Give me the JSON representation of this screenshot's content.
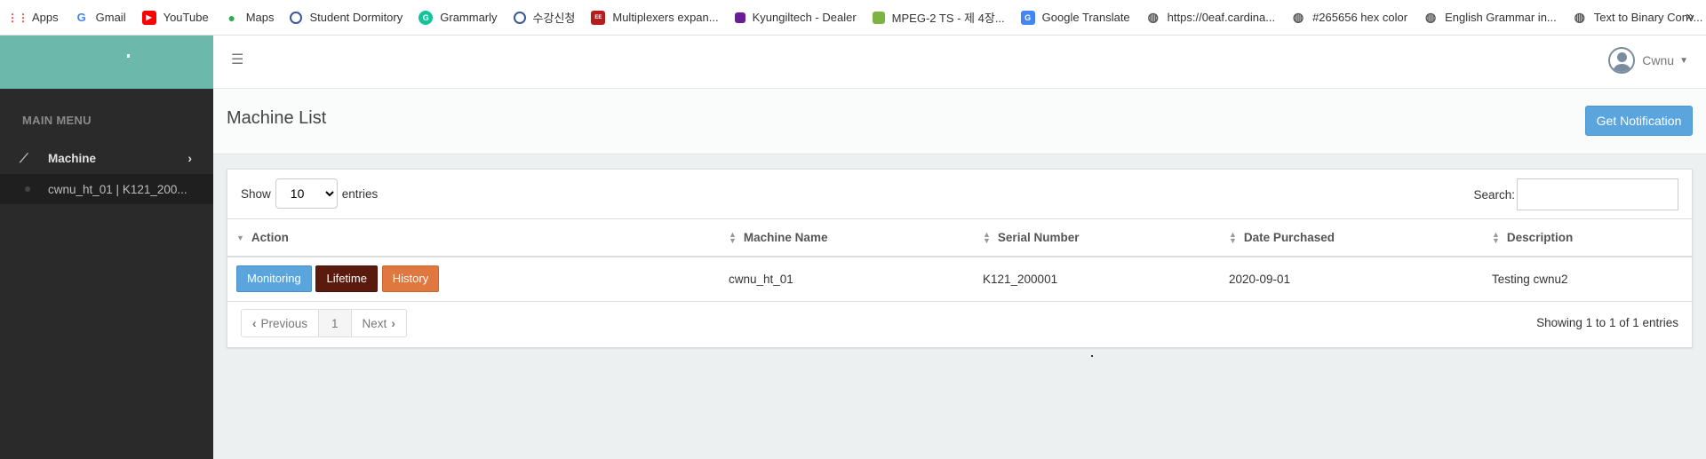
{
  "bookmarks": [
    {
      "label": "Apps",
      "icon": "apps-grid-icon",
      "color": "#ea4335"
    },
    {
      "label": "Gmail",
      "icon": "google-icon",
      "color": "#4285f4"
    },
    {
      "label": "YouTube",
      "icon": "youtube-icon",
      "color": "#ff0000"
    },
    {
      "label": "Maps",
      "icon": "maps-pin-icon",
      "color": "#34a853"
    },
    {
      "label": "Student Dormitory",
      "icon": "site-icon",
      "color": "#3b5998"
    },
    {
      "label": "Grammarly",
      "icon": "grammarly-icon",
      "color": "#15c39a"
    },
    {
      "label": "수강신청",
      "icon": "site-icon",
      "color": "#3b5998"
    },
    {
      "label": "Multiplexers expan...",
      "icon": "site-icon",
      "color": "#b71c1c"
    },
    {
      "label": "Kyungiltech - Dealer",
      "icon": "site-icon",
      "color": "#6a1b9a"
    },
    {
      "label": "MPEG-2 TS - 제 4장...",
      "icon": "site-icon",
      "color": "#7cb342"
    },
    {
      "label": "Google Translate",
      "icon": "translate-icon",
      "color": "#4285f4"
    },
    {
      "label": "https://0eaf.cardina...",
      "icon": "globe-icon",
      "color": "#555555"
    },
    {
      "label": "#265656 hex color",
      "icon": "globe-icon",
      "color": "#555555"
    },
    {
      "label": "English Grammar in...",
      "icon": "globe-icon",
      "color": "#555555"
    },
    {
      "label": "Text to Binary Conv...",
      "icon": "globe-icon",
      "color": "#555555"
    }
  ],
  "sidebar": {
    "menu_header": "MAIN MENU",
    "machine_label": "Machine",
    "sub_item": "cwnu_ht_01 | K121_200..."
  },
  "header": {
    "user_name": "Cwnu"
  },
  "page": {
    "title": "Machine List",
    "notification_button": "Get Notification"
  },
  "table_controls": {
    "show_label": "Show",
    "entries_value": "10",
    "entries_label": "entries",
    "search_label": "Search:"
  },
  "table": {
    "columns": [
      "Action",
      "Machine Name",
      "Serial Number",
      "Date Purchased",
      "Description"
    ],
    "rows": [
      {
        "actions": [
          "Monitoring",
          "Lifetime",
          "History"
        ],
        "machine_name": "cwnu_ht_01",
        "serial_number": "K121_200001",
        "date_purchased": "2020-09-01",
        "description": "Testing cwnu2"
      }
    ]
  },
  "pagination": {
    "previous": "Previous",
    "current": "1",
    "next": "Next",
    "info": "Showing 1 to 1 of 1 entries"
  },
  "colors": {
    "brand": "#6cb8ab",
    "primary": "#5aa5de",
    "lifetime": "#5a1a0e",
    "history": "#e0773e"
  }
}
